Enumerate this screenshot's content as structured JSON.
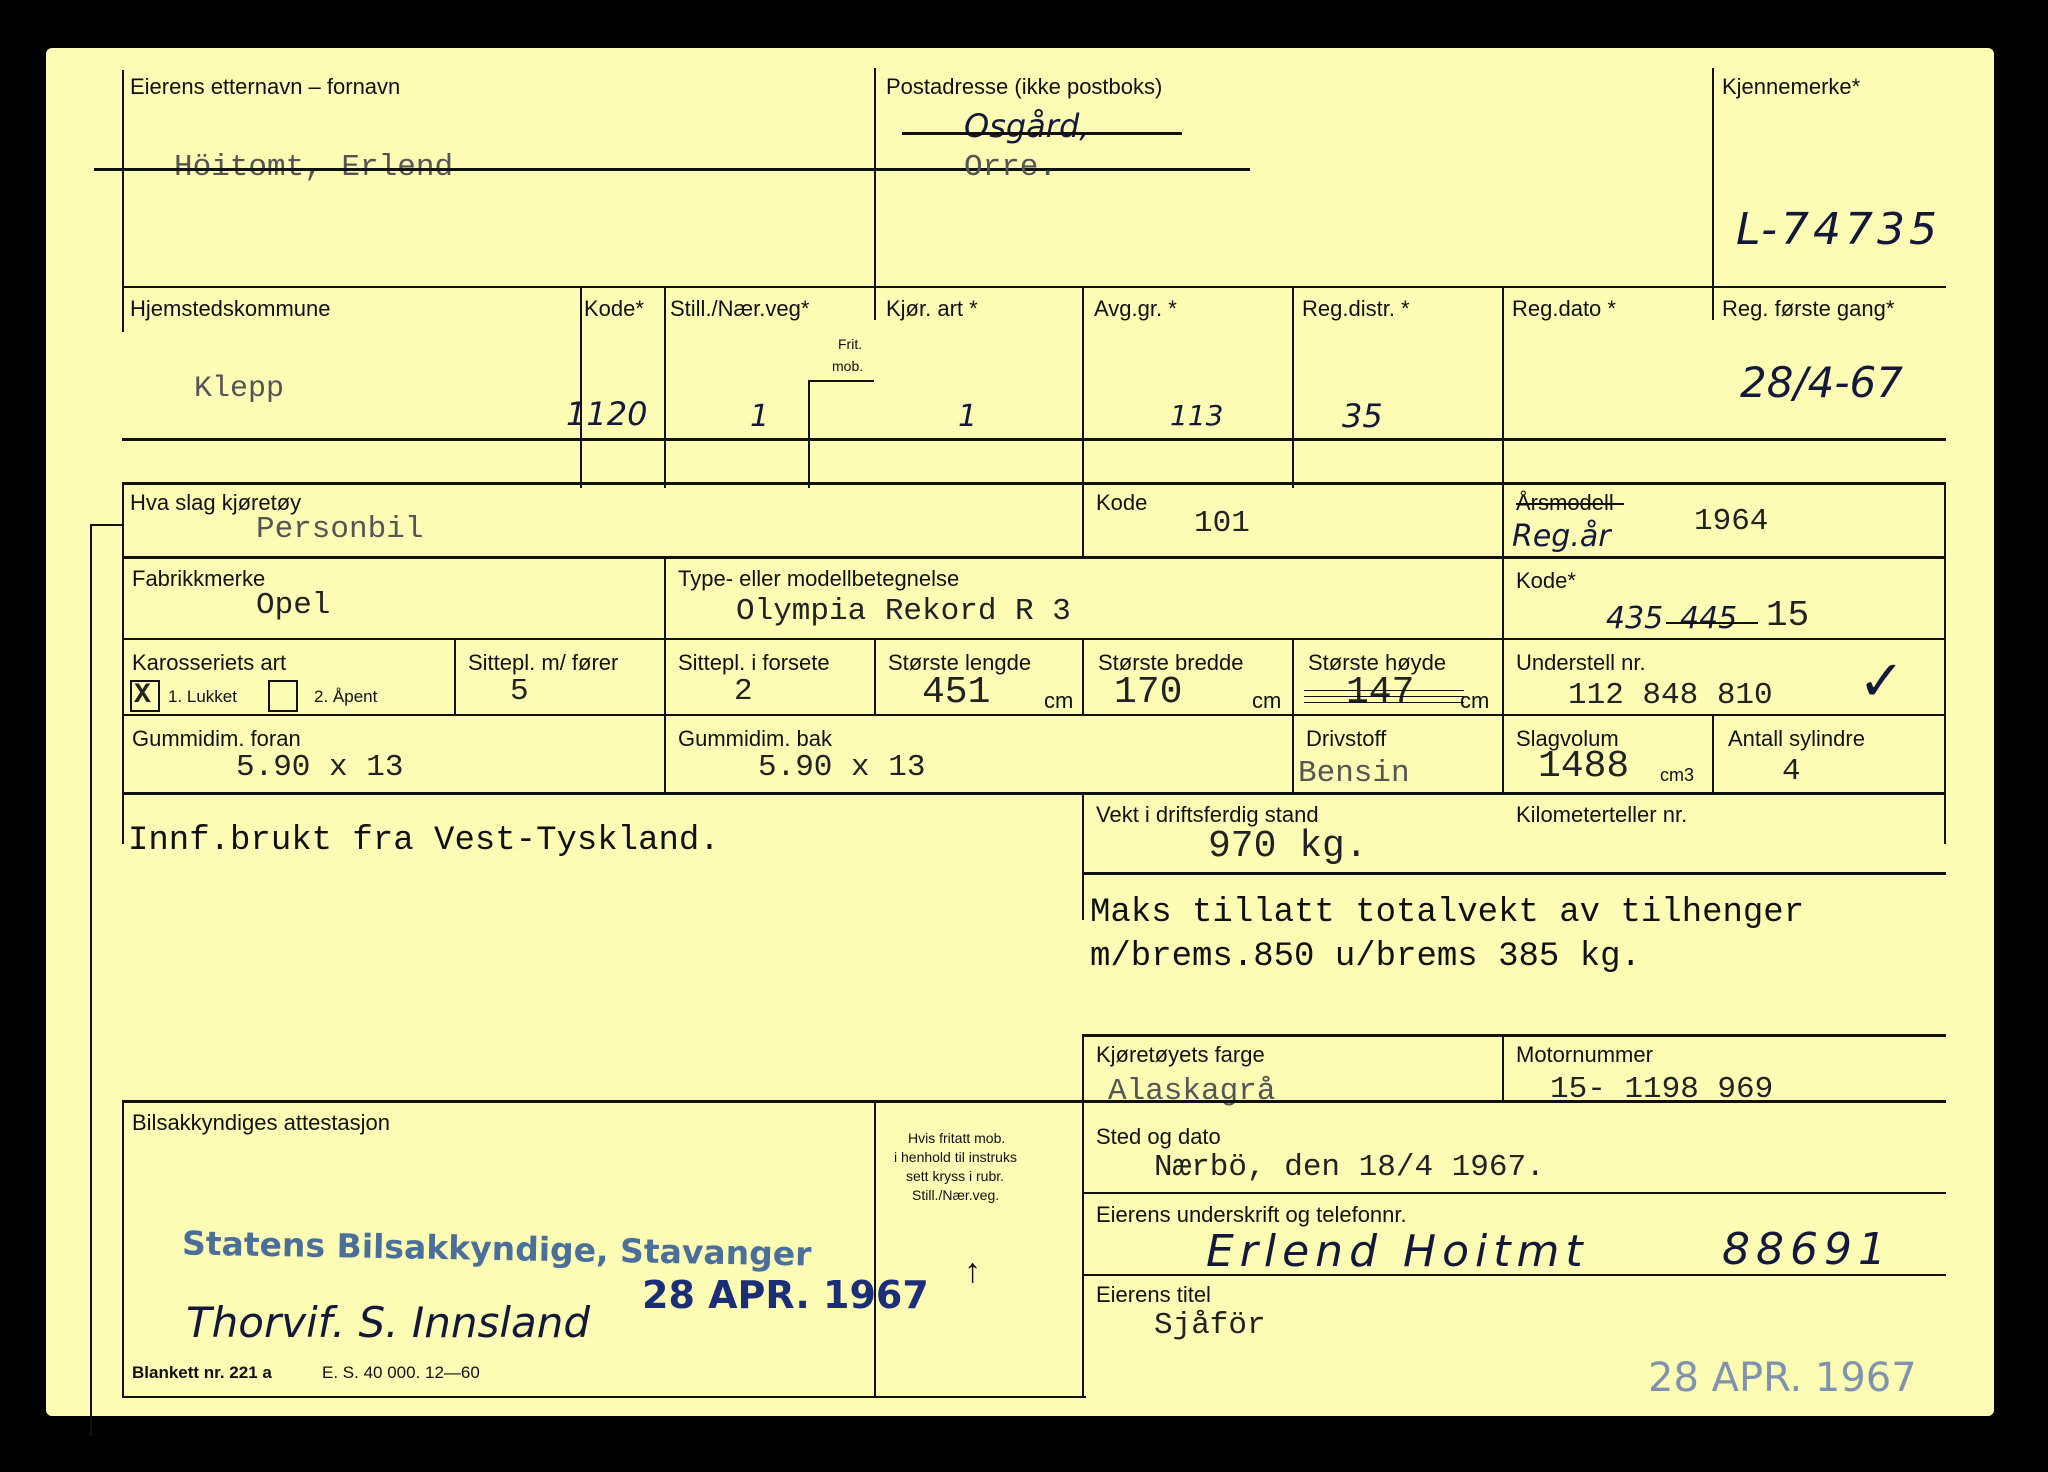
{
  "owner": {
    "name_label": "Eierens etternavn – fornavn",
    "name_value": "Höitomt, Erlend",
    "address_label": "Postadresse (ikke postboks)",
    "address_line1": "Osgård,",
    "address_line2": "Orre.",
    "reg_label": "Kjennemerke*",
    "reg_value": "L-74735"
  },
  "row2": {
    "municipality_label": "Hjemstedskommune",
    "municipality_value": "Klepp",
    "kode_label": "Kode*",
    "kode_value": "1120",
    "still_label": "Still./Nær.veg*",
    "still_value": "1",
    "frit_label": "Frit.",
    "mob_label": "mob.",
    "kjor_label": "Kjør. art *",
    "kjor_value": "1",
    "avg_label": "Avg.gr. *",
    "avg_value": "113",
    "regdistr_label": "Reg.distr. *",
    "regdistr_value": "35",
    "regdato_label": "Reg.dato *",
    "regfirst_label": "Reg. første gang*",
    "regfirst_value": "28/4-67"
  },
  "vehicle": {
    "type_label": "Hva slag kjøretøy",
    "type_value": "Personbil",
    "kode_label": "Kode",
    "kode_value": "101",
    "year_label": "Årsmodell",
    "year_hand": "Reg.år",
    "year_value": "1964",
    "make_label": "Fabrikkmerke",
    "make_value": "Opel",
    "model_label": "Type- eller modellbetegnelse",
    "model_value": "Olympia Rekord R 3",
    "kode2_label": "Kode*",
    "kode2_hand": "435",
    "kode2_struck": "445",
    "kode2_value": "15",
    "body_label": "Karosseriets art",
    "body_opt1": "1. Lukket",
    "body_opt1_mark": "X",
    "body_opt2": "2. Åpent",
    "seats_label": "Sittepl. m/ fører",
    "seats_value": "5",
    "front_seats_label": "Sittepl. i forsete",
    "front_seats_value": "2",
    "length_label": "Største lengde",
    "length_value": "451",
    "width_label": "Største bredde",
    "width_value": "170",
    "height_label": "Største høyde",
    "height_value": "147",
    "cm": "cm",
    "chassis_label": "Understell nr.",
    "chassis_value": "112 848 810",
    "check": "✓",
    "tyre_front_label": "Gummidim. foran",
    "tyre_front_value": "5.90 x 13",
    "tyre_rear_label": "Gummidim. bak",
    "tyre_rear_value": "5.90 x 13",
    "fuel_label": "Drivstoff",
    "fuel_value": "Bensin",
    "volume_label": "Slagvolum",
    "volume_value": "1488",
    "volume_unit": "cm3",
    "cyl_label": "Antall sylindre",
    "cyl_value": "4",
    "weight_label": "Vekt i driftsferdig stand",
    "weight_value": "970 kg.",
    "km_label": "Kilometerteller nr."
  },
  "notes": {
    "import": "Innf.brukt fra Vest-Tyskland.",
    "trailer_line1": "Maks tillatt totalvekt av tilhenger",
    "trailer_line2_a": "m/brems.",
    "trailer_line2_b": "850",
    "trailer_line2_c": " u/brems ",
    "trailer_line2_d": "385",
    "trailer_line2_e": " kg."
  },
  "colour": {
    "label": "Kjøretøyets farge",
    "value": "Alaskagrå",
    "motor_label": "Motornummer",
    "motor_value": "15- 1198 969"
  },
  "attest": {
    "label": "Bilsakkyndiges attestasjon",
    "note": [
      "Hvis fritatt mob.",
      "i henhold til instruks",
      "sett kryss i rubr.",
      "Still./Nær.veg."
    ],
    "arrow": "↑",
    "stamp_name": "Statens Bilsakkyndige, Stavanger",
    "signature": "Thorvif. S. Innsland",
    "stamp_date": "28 APR. 1967"
  },
  "place": {
    "label": "Sted og dato",
    "value": "Nærbö, den 18/4 1967.",
    "sign_label": "Eierens underskrift og telefonnr.",
    "sign_value": "Erlend Hoitmt",
    "phone_value": "88691",
    "title_label": "Eierens titel",
    "title_value": "Sjåför"
  },
  "footer": {
    "form_no": "Blankett nr. 221 a",
    "print_info": "E. S. 40 000. 12—60",
    "bottom_stamp": "28 APR. 1967"
  }
}
